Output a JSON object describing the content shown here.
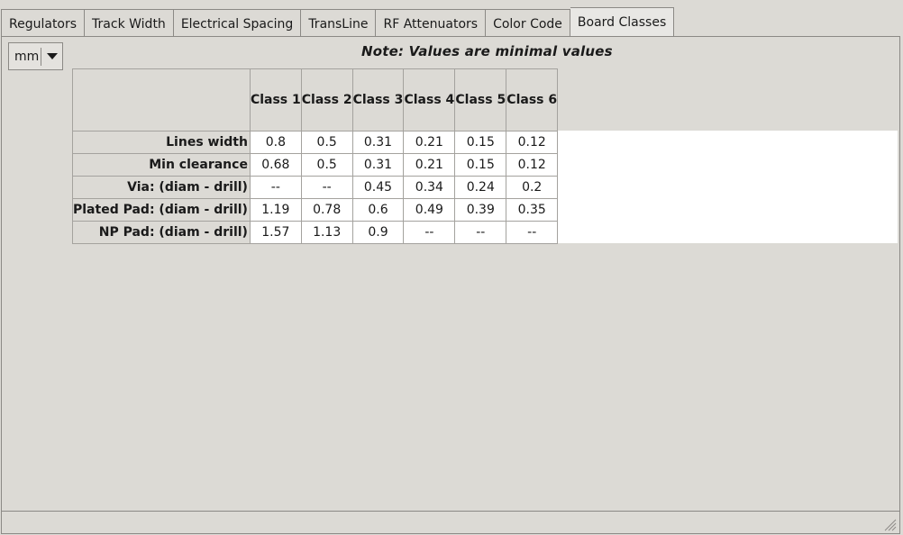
{
  "tabs": [
    {
      "label": "Regulators",
      "active": false
    },
    {
      "label": "Track Width",
      "active": false
    },
    {
      "label": "Electrical Spacing",
      "active": false
    },
    {
      "label": "TransLine",
      "active": false
    },
    {
      "label": "RF Attenuators",
      "active": false
    },
    {
      "label": "Color Code",
      "active": false
    },
    {
      "label": "Board Classes",
      "active": true
    }
  ],
  "unit_select": {
    "value": "mm"
  },
  "note": "Note: Values are minimal values",
  "table": {
    "columns": [
      "Class 1",
      "Class 2",
      "Class 3",
      "Class 4",
      "Class 5",
      "Class 6"
    ],
    "rows": [
      {
        "label": "Lines width",
        "values": [
          "0.8",
          "0.5",
          "0.31",
          "0.21",
          "0.15",
          "0.12"
        ]
      },
      {
        "label": "Min clearance",
        "values": [
          "0.68",
          "0.5",
          "0.31",
          "0.21",
          "0.15",
          "0.12"
        ]
      },
      {
        "label": "Via: (diam - drill)",
        "values": [
          "--",
          "--",
          "0.45",
          "0.34",
          "0.24",
          "0.2"
        ]
      },
      {
        "label": "Plated Pad: (diam - drill)",
        "values": [
          "1.19",
          "0.78",
          "0.6",
          "0.49",
          "0.39",
          "0.35"
        ]
      },
      {
        "label": "NP Pad: (diam - drill)",
        "values": [
          "1.57",
          "1.13",
          "0.9",
          "--",
          "--",
          "--"
        ]
      }
    ]
  },
  "colors": {
    "window_bg": "#dcdad5",
    "cell_bg": "#ffffff",
    "border": "#8b8985"
  }
}
